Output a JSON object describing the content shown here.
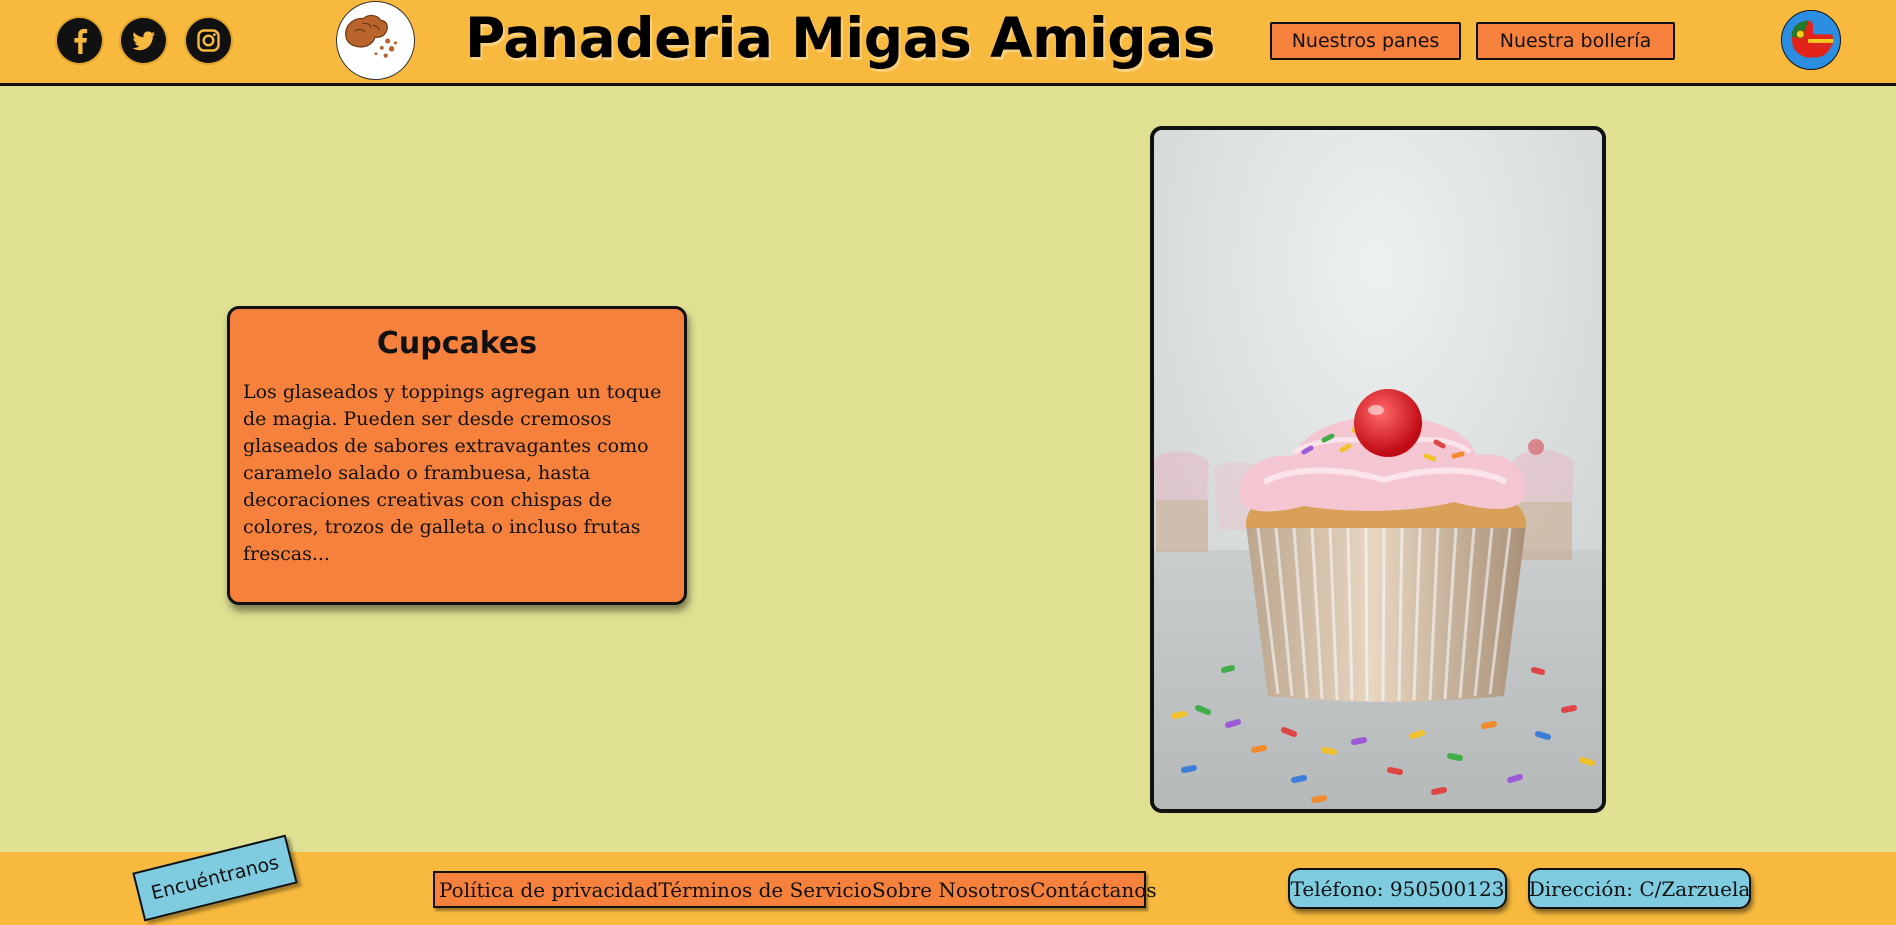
{
  "header": {
    "site_title": "Panaderia Migas Amigas",
    "social": [
      "facebook-icon",
      "twitter-icon",
      "instagram-icon"
    ],
    "nav": {
      "breads_label": "Nuestros panes",
      "pastries_label": "Nuestra bollería"
    },
    "logo_icon": "bread-logo-icon",
    "language_icon": "language-flag-icon"
  },
  "card": {
    "title": "Cupcakes",
    "text": "Los glaseados y toppings agregan un toque de magia. Pueden ser desde cremosos glaseados de sabores extravagantes como caramelo salado o frambuesa, hasta decoraciones creativas con chispas de colores, trozos de galleta o incluso frutas frescas..."
  },
  "footer": {
    "find_us_label": "Encuéntranos",
    "links": [
      "Política de privacidad",
      "Términos de Servicio",
      "Sobre Nosotros",
      "Contáctanos"
    ],
    "phone": "Teléfono: 950500123",
    "address": "Dirección: C/Zarzuela"
  },
  "colors": {
    "background": "#e0e093",
    "header": "#f7b93e",
    "accent_orange": "#f5813c",
    "accent_blue": "#7fcbe0"
  }
}
